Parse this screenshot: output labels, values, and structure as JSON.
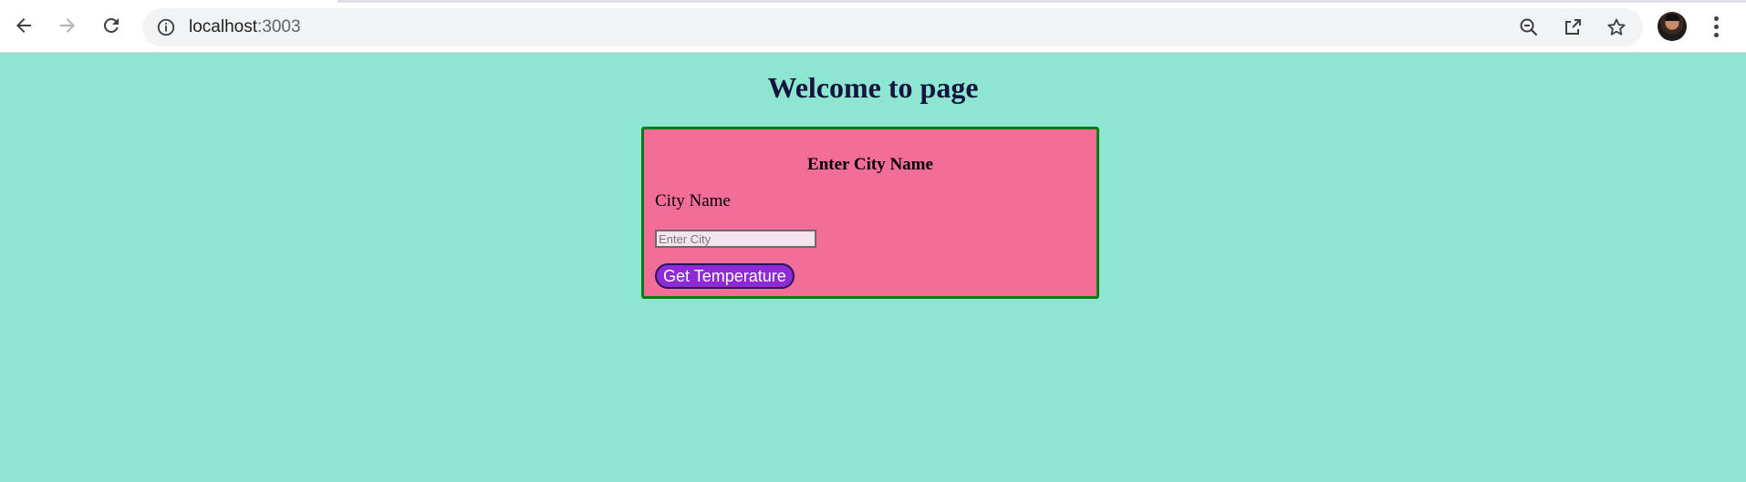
{
  "browser": {
    "url_host": "localhost",
    "url_port": ":3003",
    "icons": {
      "back": "arrow-left-icon",
      "forward": "arrow-right-icon",
      "reload": "reload-icon",
      "site_info": "info-icon",
      "zoom": "zoom-out-icon",
      "share": "share-icon",
      "bookmark": "star-icon",
      "menu": "kebab-menu-icon"
    }
  },
  "page": {
    "title": "Welcome to page",
    "background_color": "#8de6d2",
    "card": {
      "heading": "Enter City Name",
      "label": "City Name",
      "input_value": "",
      "input_placeholder": "Enter City",
      "button_label": "Get Temperature",
      "card_color": "#f36d99",
      "border_color": "#0d7a12",
      "button_color": "#8e2bd6"
    }
  }
}
